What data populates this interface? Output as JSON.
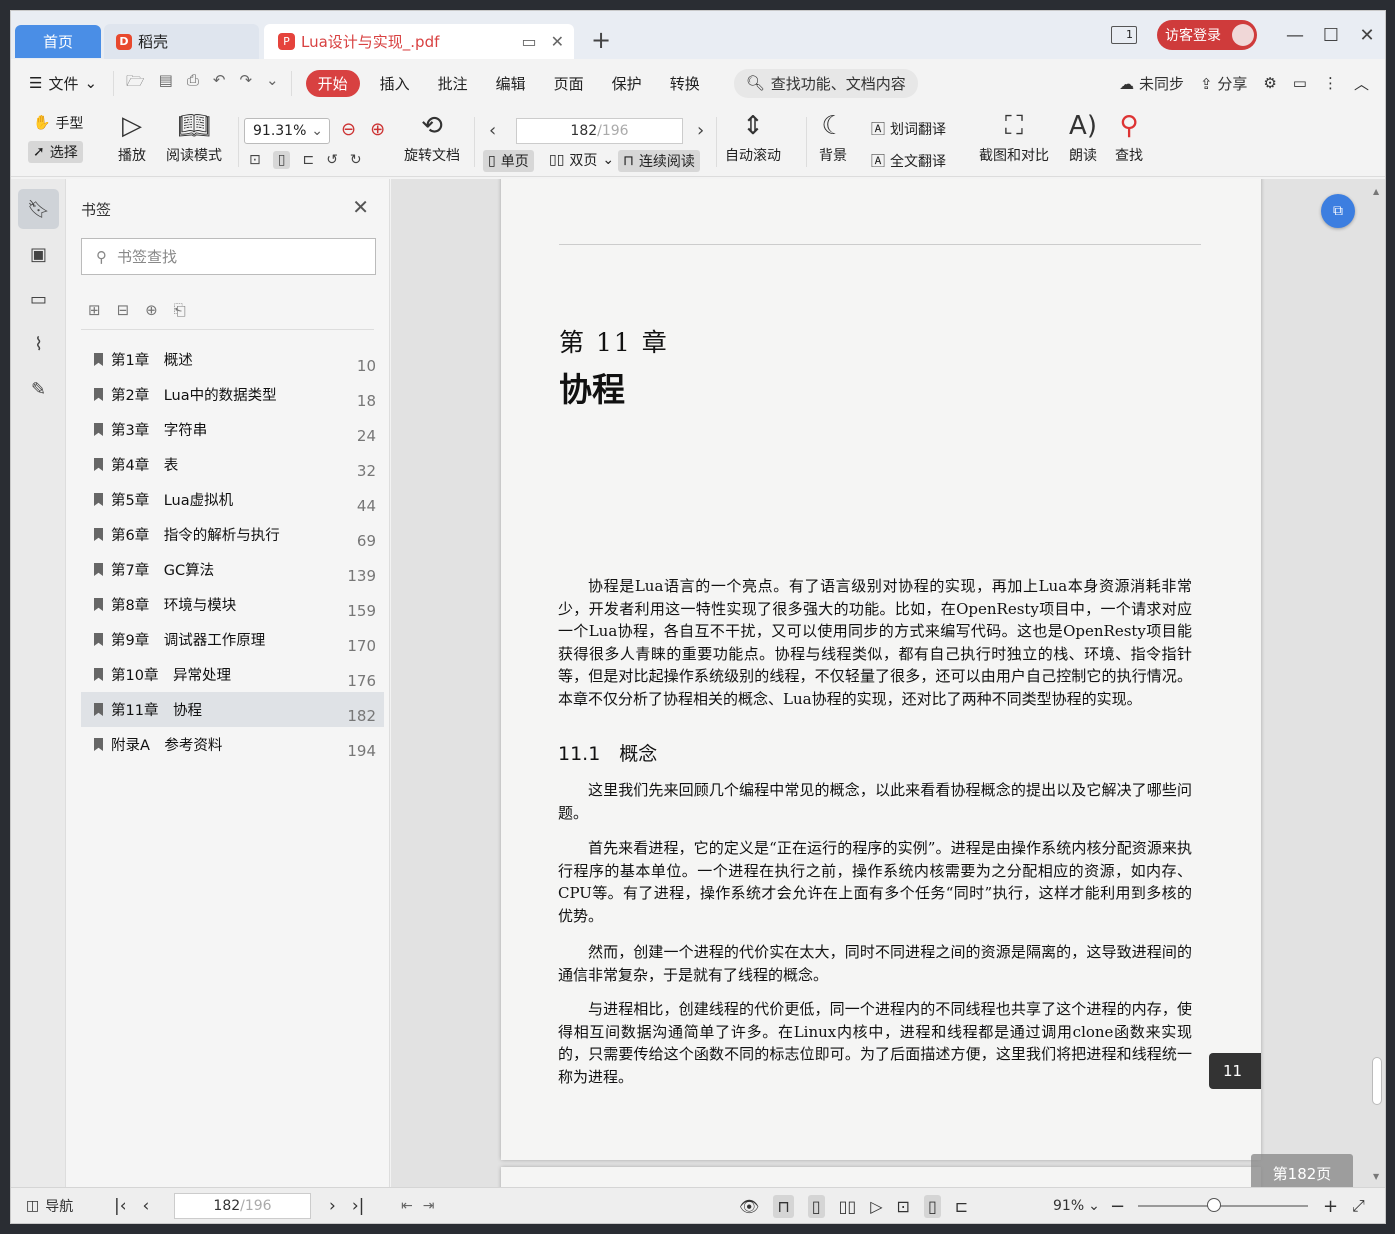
{
  "tabs": {
    "home": "首页",
    "doc1": "稻壳",
    "doc2": "Lua设计与实现_.pdf",
    "new_tab": "+"
  },
  "titlebar": {
    "pane_indicator": "1",
    "login": "访客登录"
  },
  "menu": {
    "file": "文件",
    "items": [
      "开始",
      "插入",
      "批注",
      "编辑",
      "页面",
      "保护",
      "转换"
    ],
    "search": "查找功能、文档内容",
    "sync": "未同步",
    "share": "分享"
  },
  "toolbar": {
    "hand": "手型",
    "select": "选择",
    "play": "播放",
    "read_mode": "阅读模式",
    "zoom": "91.31%",
    "rotate": "旋转文档",
    "page_current": "182",
    "page_total": "/196",
    "single": "单页",
    "double": "双页",
    "continuous": "连续阅读",
    "auto_scroll": "自动滚动",
    "background": "背景",
    "word_translate": "划词翻译",
    "full_translate": "全文翻译",
    "screenshot": "截图和对比",
    "read_aloud": "朗读",
    "find": "查找"
  },
  "bookmarks": {
    "title": "书签",
    "search_placeholder": "书签查找",
    "items": [
      {
        "label": "第1章　概述",
        "page": "10"
      },
      {
        "label": "第2章　Lua中的数据类型",
        "page": "18"
      },
      {
        "label": "第3章　字符串",
        "page": "24"
      },
      {
        "label": "第4章　表",
        "page": "32"
      },
      {
        "label": "第5章　Lua虚拟机",
        "page": "44"
      },
      {
        "label": "第6章　指令的解析与执行",
        "page": "69"
      },
      {
        "label": "第7章　GC算法",
        "page": "139"
      },
      {
        "label": "第8章　环境与模块",
        "page": "159"
      },
      {
        "label": "第9章　调试器工作原理",
        "page": "170"
      },
      {
        "label": "第10章　异常处理",
        "page": "176"
      },
      {
        "label": "第11章　协程",
        "page": "182"
      },
      {
        "label": "附录A　参考资料",
        "page": "194"
      }
    ]
  },
  "page": {
    "chapter_number": "第 11 章",
    "chapter_title": "协程",
    "intro": "协程是Lua语言的一个亮点。有了语言级别对协程的实现，再加上Lua本身资源消耗非常少，开发者利用这一特性实现了很多强大的功能。比如，在OpenResty项目中，一个请求对应一个Lua协程，各自互不干扰，又可以使用同步的方式来编写代码。这也是OpenResty项目能获得很多人青睐的重要功能点。协程与线程类似，都有自己执行时独立的栈、环境、指令指针等，但是对比起操作系统级别的线程，不仅轻量了很多，还可以由用户自己控制它的执行情况。本章不仅分析了协程相关的概念、Lua协程的实现，还对比了两种不同类型协程的实现。",
    "section": "11.1　概念",
    "p1": "这里我们先来回顾几个编程中常见的概念，以此来看看协程概念的提出以及它解决了哪些问题。",
    "p2": "首先来看进程，它的定义是“正在运行的程序的实例”。进程是由操作系统内核分配资源来执行程序的基本单位。一个进程在执行之前，操作系统内核需要为之分配相应的资源，如内存、CPU等。有了进程，操作系统才会允许在上面有多个任务“同时”执行，这样才能利用到多核的优势。",
    "p3": "然而，创建一个进程的代价实在太大，同时不同进程之间的资源是隔离的，这导致进程间的通信非常复杂，于是就有了线程的概念。",
    "p4": "与进程相比，创建线程的代价更低，同一个进程内的不同线程也共享了这个进程的内存，使得相互间数据沟通简单了许多。在Linux内核中，进程和线程都是通过调用clone函数来实现的，只需要传给这个函数不同的标志位即可。为了后面描述方便，这里我们将把进程和线程统一称为进程。",
    "thumb": "11",
    "indicator": "第182页"
  },
  "status": {
    "nav": "导航",
    "page_current": "182",
    "page_total": "/196",
    "zoom": "91%"
  }
}
